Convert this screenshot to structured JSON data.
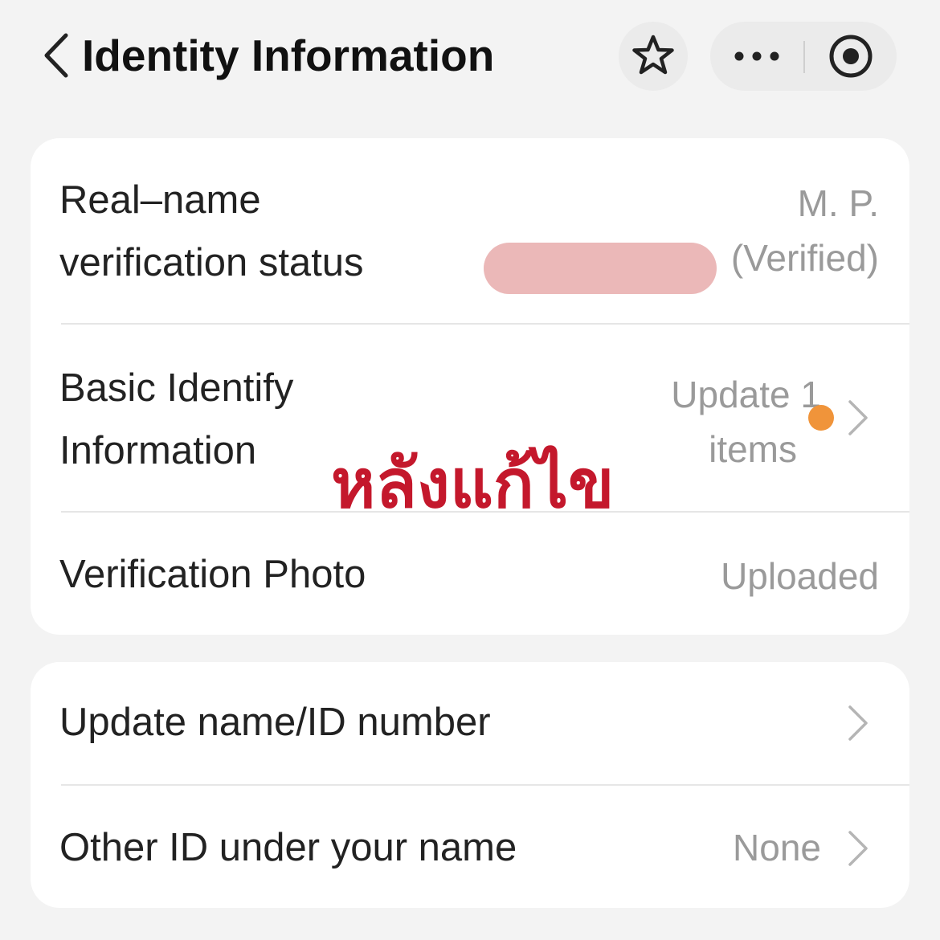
{
  "header": {
    "title": "Identity Information"
  },
  "card1": {
    "rows": [
      {
        "label_line1": "Real–name",
        "label_line2": "verification status",
        "value_line1": "M. P.",
        "value_line2": "(Verified)"
      },
      {
        "label_line1": "Basic Identify",
        "label_line2": "Information",
        "value_line1": "Update 1",
        "value_line2": "items"
      },
      {
        "label": "Verification Photo",
        "value": "Uploaded"
      }
    ]
  },
  "card2": {
    "rows": [
      {
        "label": "Update name/ID number"
      },
      {
        "label": "Other ID under your name",
        "value": "None"
      }
    ]
  },
  "overlay": {
    "thai_text": "หลังแก้ไข"
  },
  "colors": {
    "background": "#f3f3f3",
    "card": "#ffffff",
    "label_text": "#222222",
    "value_text": "#9a9a9a",
    "notification_dot": "#f0943a",
    "overlay_text": "#c4182c",
    "redaction": "#ebb8b8"
  },
  "icons": {
    "back": "chevron-left-icon",
    "favorite": "star-icon",
    "more": "more-horizontal-icon",
    "close": "target-close-icon",
    "row_arrow": "chevron-right-icon"
  }
}
